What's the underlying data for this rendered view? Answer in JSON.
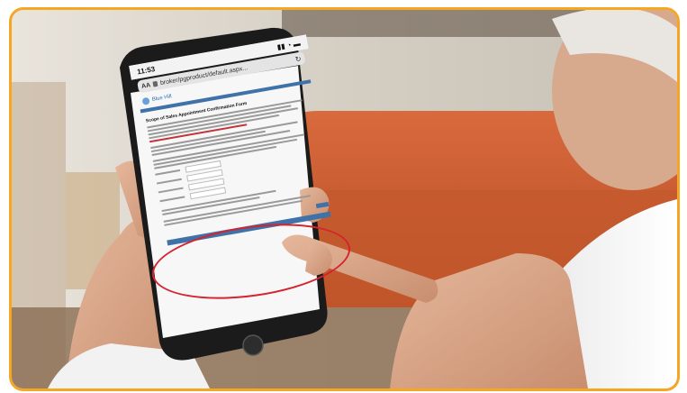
{
  "phone": {
    "time": "11:53",
    "url": "broker/pgproduct/default.aspx...",
    "aa_label": "AA",
    "site_label": "Blue Hill"
  },
  "doc": {
    "title": "Scope of Sales Appointment Confirmation Form"
  },
  "colors": {
    "frame_border": "#f5a623",
    "annotation": "#d5232f",
    "accent_blue": "#3e72a8"
  },
  "icons": [
    "lock-icon",
    "reload-icon",
    "logo-icon",
    "signal-icon"
  ]
}
